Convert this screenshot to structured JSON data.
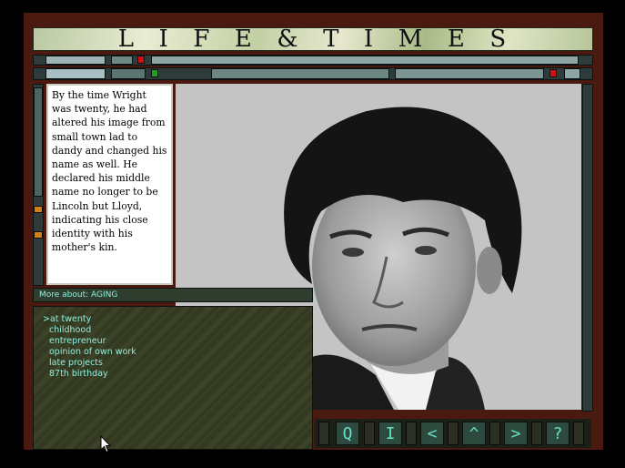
{
  "title": {
    "text": "LIFE&TIMES",
    "letters": [
      "L",
      "I",
      "F",
      "E",
      "&",
      "T",
      "I",
      "M",
      "E",
      "S"
    ]
  },
  "body_text": "By the time Wright was twenty, he had altered his image from small town lad to dandy and changed his name as well. He declared his middle name no longer to be Lincoln but Lloyd, indicating his close identity with his mother's kin.",
  "more_about": {
    "label": "More about: AGING",
    "items": [
      ">at twenty",
      "childhood",
      "entrepreneur",
      "opinion of own work",
      "late projects",
      "87th birthday"
    ]
  },
  "nav": {
    "buttons": [
      {
        "glyph": "Q",
        "icon": "search-icon"
      },
      {
        "glyph": "I",
        "icon": "info-icon"
      },
      {
        "glyph": "<",
        "icon": "previous-icon"
      },
      {
        "glyph": "^",
        "icon": "up-icon"
      },
      {
        "glyph": ">",
        "icon": "next-icon"
      },
      {
        "glyph": "?",
        "icon": "help-icon"
      }
    ]
  },
  "colors": {
    "frame": "#4a1a10",
    "accent_text": "#8ff0df",
    "nav_glyph": "#64e0c4",
    "red_light": "#d01010",
    "green_light": "#20a020"
  }
}
